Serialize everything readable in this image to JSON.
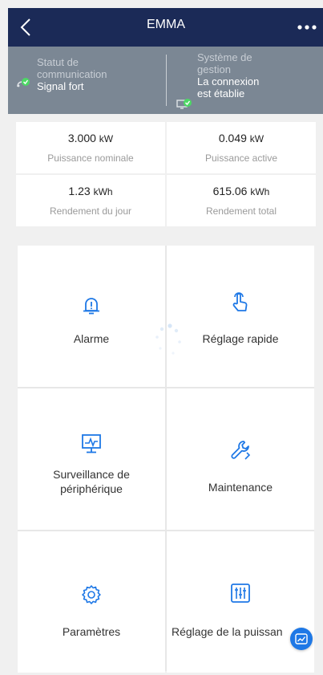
{
  "header": {
    "title": "EMMA",
    "back_icon": "chevron-left-icon",
    "more_icon": "more-dots-icon"
  },
  "status": {
    "communication": {
      "label_line1": "Statut de",
      "label_line2": "communication",
      "value": "Signal fort",
      "icon": "signal-check-icon"
    },
    "management": {
      "label_line1": "Système de",
      "label_line2": "gestion",
      "value_line1": "La connexion",
      "value_line2": "est établie",
      "icon": "monitor-check-icon"
    }
  },
  "metrics": [
    {
      "value": "3.000",
      "unit": "kW",
      "label": "Puissance nominale"
    },
    {
      "value": "0.049",
      "unit": "kW",
      "label": "Puissance active"
    },
    {
      "value": "1.23",
      "unit": "kWh",
      "label": "Rendement du jour"
    },
    {
      "value": "615.06",
      "unit": "kWh",
      "label": "Rendement total"
    }
  ],
  "tiles": [
    {
      "label_line1": "Alarme",
      "label_line2": "",
      "icon": "alarm-bell-icon"
    },
    {
      "label_line1": "Réglage rapide",
      "label_line2": "",
      "icon": "tap-hand-icon"
    },
    {
      "label_line1": "Surveillance de",
      "label_line2": "périphérique",
      "icon": "monitor-wave-icon"
    },
    {
      "label_line1": "Maintenance",
      "label_line2": "",
      "icon": "wrench-icon"
    },
    {
      "label_line1": "Paramètres",
      "label_line2": "",
      "icon": "gear-icon"
    },
    {
      "label_line1": "Réglage de la puissan",
      "label_line2": "",
      "icon": "sliders-icon"
    }
  ],
  "fab": {
    "icon": "chart-line-icon"
  },
  "colors": {
    "header_bg": "#1b2a57",
    "status_bg": "#7b8794",
    "accent": "#1e78e6",
    "status_ok": "#4cd964"
  }
}
